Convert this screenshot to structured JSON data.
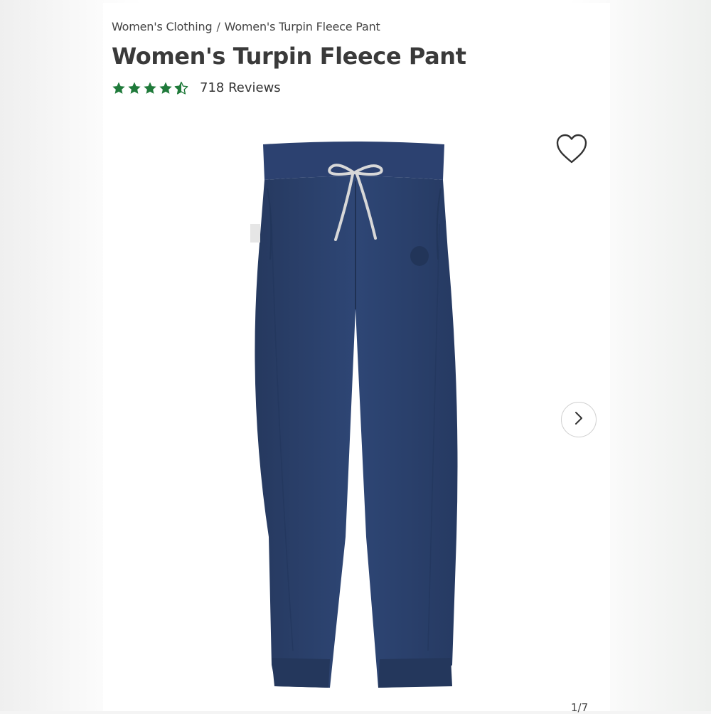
{
  "breadcrumb": {
    "parent": "Women's Clothing",
    "separator": "/",
    "current": "Women's Turpin Fleece Pant"
  },
  "product": {
    "title": "Women's Turpin Fleece Pant",
    "rating": 4.5,
    "rating_max": 5,
    "reviews_label": "718 Reviews",
    "star_color": "#1f7a3a",
    "main_color": "#2b4272"
  },
  "gallery": {
    "counter": "1/7",
    "current_index": 1,
    "total": 7
  },
  "icons": {
    "wishlist": "heart-outline-icon",
    "next": "chevron-right-icon"
  }
}
